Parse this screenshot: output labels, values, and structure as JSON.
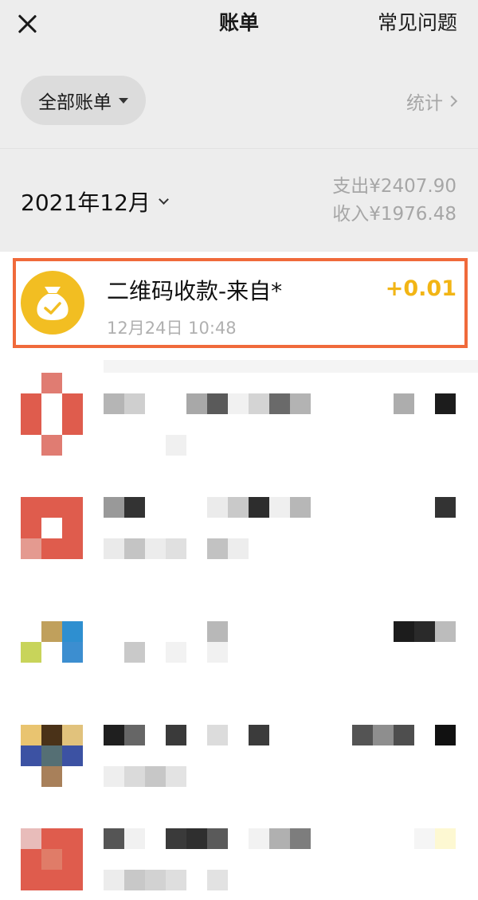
{
  "nav": {
    "title": "账单",
    "faq_label": "常见问题"
  },
  "filter": {
    "label": "全部账单",
    "stats_label": "统计"
  },
  "month": {
    "label": "2021年12月",
    "expense": "支出¥2407.90",
    "income": "收入¥1976.48"
  },
  "highlighted_transaction": {
    "title": "二维码收款-来自*",
    "time": "12月24日 10:48",
    "amount": "+0.01",
    "icon": "money-bag-icon",
    "amount_color": "#f2b515"
  },
  "colors": {
    "highlight_border": "#f06a3b",
    "accent_yellow": "#f2be22",
    "page_bg": "#ededed"
  }
}
